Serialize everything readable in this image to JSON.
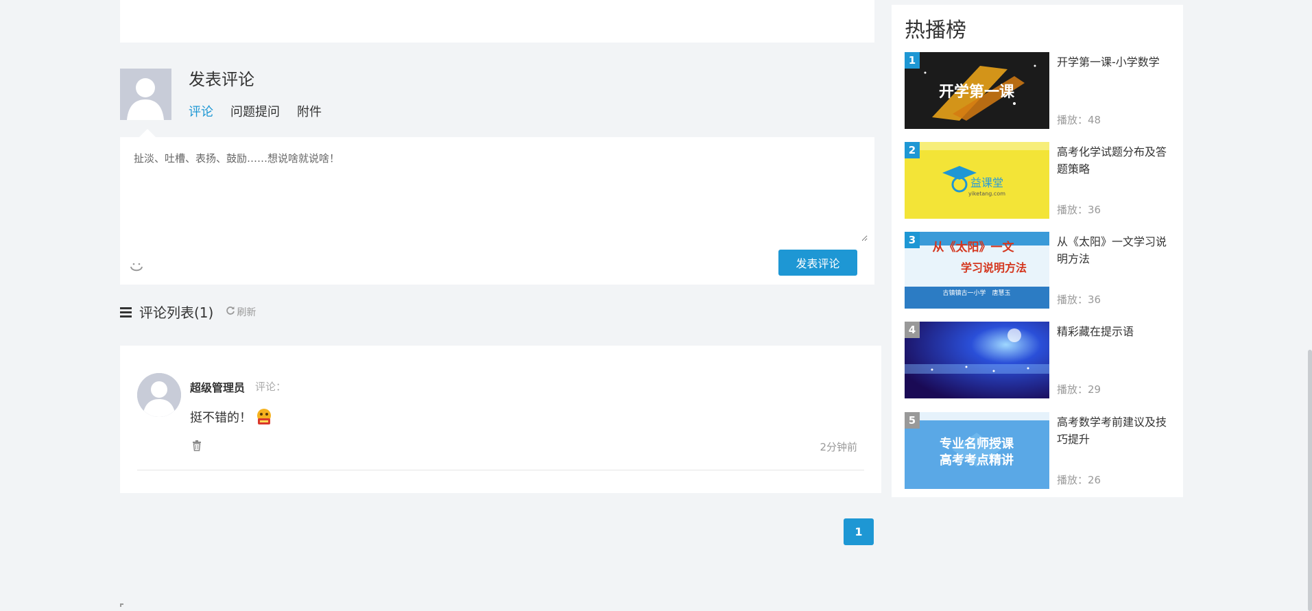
{
  "composer": {
    "title": "发表评论",
    "tabs": [
      "评论",
      "问题提问",
      "附件"
    ],
    "placeholder": "扯淡、吐槽、表扬、鼓励……想说啥就说啥！",
    "submit_label": "发表评论",
    "smile_icon": "smile-icon"
  },
  "comment_list": {
    "title": "评论列表(1)",
    "refresh_label": "刷新",
    "items": [
      {
        "author": "超级管理员",
        "verb": "评论：",
        "text": "挺不错的！",
        "emoji": "thumbs-up-emoji",
        "time": "2分钟前"
      }
    ]
  },
  "pagination": {
    "current": "1"
  },
  "sidebar": {
    "title": "热播榜",
    "items": [
      {
        "rank": "1",
        "title": "开学第一课-小学数学",
        "plays": "播放：48",
        "badge_color": "#1e97d4"
      },
      {
        "rank": "2",
        "title": "高考化学试题分布及答题策略",
        "plays": "播放：36",
        "badge_color": "#1e97d4"
      },
      {
        "rank": "3",
        "title": "从《太阳》一文学习说明方法",
        "plays": "播放：36",
        "badge_color": "#1e97d4"
      },
      {
        "rank": "4",
        "title": "精彩藏在提示语",
        "plays": "播放：29",
        "badge_color": "#999999"
      },
      {
        "rank": "5",
        "title": "高考数学考前建议及技巧提升",
        "plays": "播放：26",
        "badge_color": "#999999"
      }
    ],
    "thumb_texts": {
      "t1": "开学第一课",
      "t2a": "益课堂",
      "t2b": "yiketang.com",
      "t3a": "从《太阳》一文",
      "t3b": "学习说明方法",
      "t3c": "古镇镇古一小学　唐慧玉",
      "t5a": "专业名师授课",
      "t5b": "高考考点精讲"
    }
  },
  "colors": {
    "accent": "#1e97d4",
    "background": "#f2f4f6"
  }
}
